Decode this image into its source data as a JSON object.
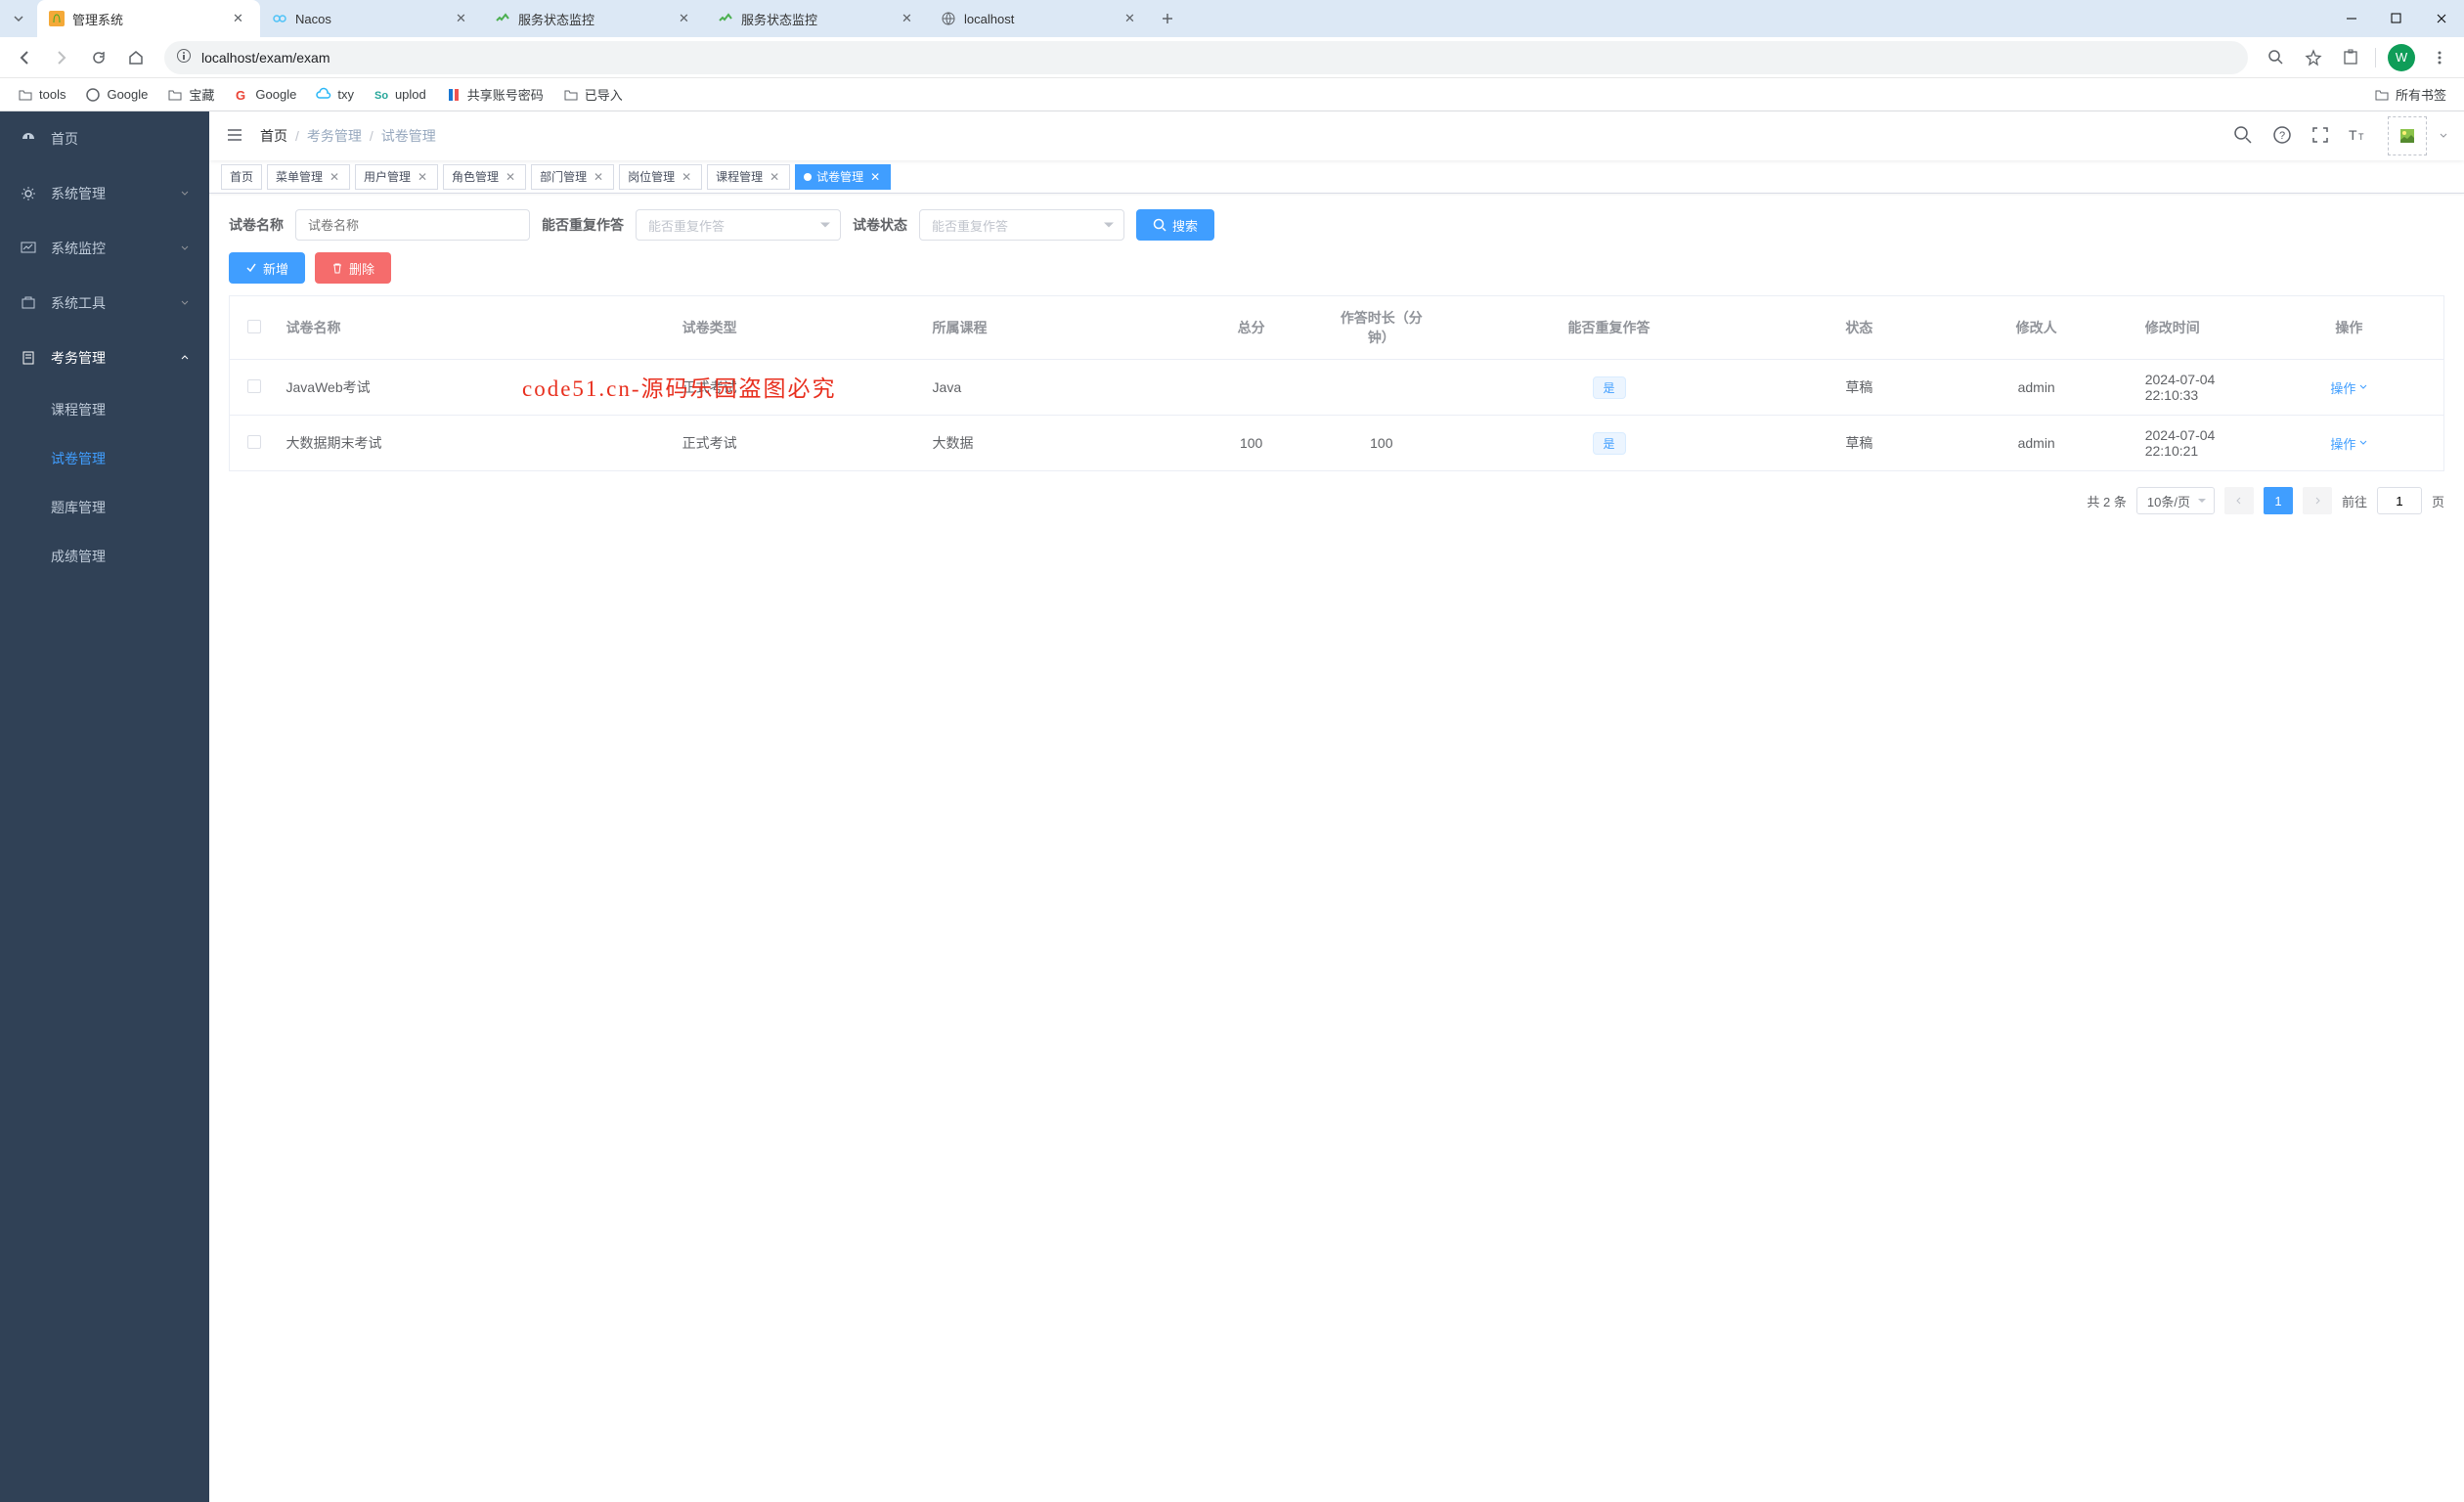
{
  "browser": {
    "tabs": [
      {
        "title": "管理系统",
        "favicon": "orange"
      },
      {
        "title": "Nacos",
        "favicon": "nacos"
      },
      {
        "title": "服务状态监控",
        "favicon": "monitor"
      },
      {
        "title": "服务状态监控",
        "favicon": "monitor"
      },
      {
        "title": "localhost",
        "favicon": "globe"
      }
    ],
    "url": "localhost/exam/exam",
    "profile_letter": "W",
    "bookmarks": [
      {
        "label": "tools",
        "icon": "folder"
      },
      {
        "label": "Google",
        "icon": "google-g"
      },
      {
        "label": "宝藏",
        "icon": "folder"
      },
      {
        "label": "Google",
        "icon": "google-c"
      },
      {
        "label": "txy",
        "icon": "txy"
      },
      {
        "label": "uplod",
        "icon": "uplod"
      },
      {
        "label": "共享账号密码",
        "icon": "share"
      },
      {
        "label": "已导入",
        "icon": "folder"
      }
    ],
    "all_bookmarks_label": "所有书签"
  },
  "sidebar": {
    "items": [
      {
        "label": "首页",
        "icon": "dashboard",
        "expandable": false
      },
      {
        "label": "系统管理",
        "icon": "gear",
        "expandable": true
      },
      {
        "label": "系统监控",
        "icon": "monitor",
        "expandable": true
      },
      {
        "label": "系统工具",
        "icon": "tool",
        "expandable": true
      },
      {
        "label": "考务管理",
        "icon": "book",
        "expandable": true,
        "expanded": true,
        "children": [
          {
            "label": "课程管理"
          },
          {
            "label": "试卷管理",
            "active": true
          },
          {
            "label": "题库管理"
          },
          {
            "label": "成绩管理"
          }
        ]
      }
    ]
  },
  "breadcrumb": {
    "home": "首页",
    "sep": "/",
    "mid": "考务管理",
    "last": "试卷管理"
  },
  "tags": [
    {
      "label": "首页",
      "closable": false
    },
    {
      "label": "菜单管理",
      "closable": true
    },
    {
      "label": "用户管理",
      "closable": true
    },
    {
      "label": "角色管理",
      "closable": true
    },
    {
      "label": "部门管理",
      "closable": true
    },
    {
      "label": "岗位管理",
      "closable": true
    },
    {
      "label": "课程管理",
      "closable": true
    },
    {
      "label": "试卷管理",
      "closable": true,
      "active": true
    }
  ],
  "search": {
    "name_label": "试卷名称",
    "name_placeholder": "试卷名称",
    "repeat_label": "能否重复作答",
    "repeat_placeholder": "能否重复作答",
    "status_label": "试卷状态",
    "status_placeholder": "能否重复作答",
    "search_btn": "搜索"
  },
  "actions": {
    "add": "新增",
    "delete": "删除"
  },
  "table": {
    "columns": [
      "试卷名称",
      "试卷类型",
      "所属课程",
      "总分",
      "作答时长（分钟）",
      "能否重复作答",
      "状态",
      "修改人",
      "修改时间",
      "操作"
    ],
    "rows": [
      {
        "name": "JavaWeb考试",
        "type": "正式考试",
        "course": "Java",
        "total": "",
        "duration": "",
        "repeat": "是",
        "status": "草稿",
        "editor": "admin",
        "time": "2024-07-04 22:10:33",
        "op": "操作"
      },
      {
        "name": "大数据期末考试",
        "type": "正式考试",
        "course": "大数据",
        "total": "100",
        "duration": "100",
        "repeat": "是",
        "status": "草稿",
        "editor": "admin",
        "time": "2024-07-04 22:10:21",
        "op": "操作"
      }
    ]
  },
  "pagination": {
    "total": "共 2 条",
    "per_page": "10条/页",
    "current": "1",
    "goto_label": "前往",
    "goto_value": "1",
    "page_suffix": "页"
  },
  "watermark": "code51.cn-源码乐园盗图必究"
}
